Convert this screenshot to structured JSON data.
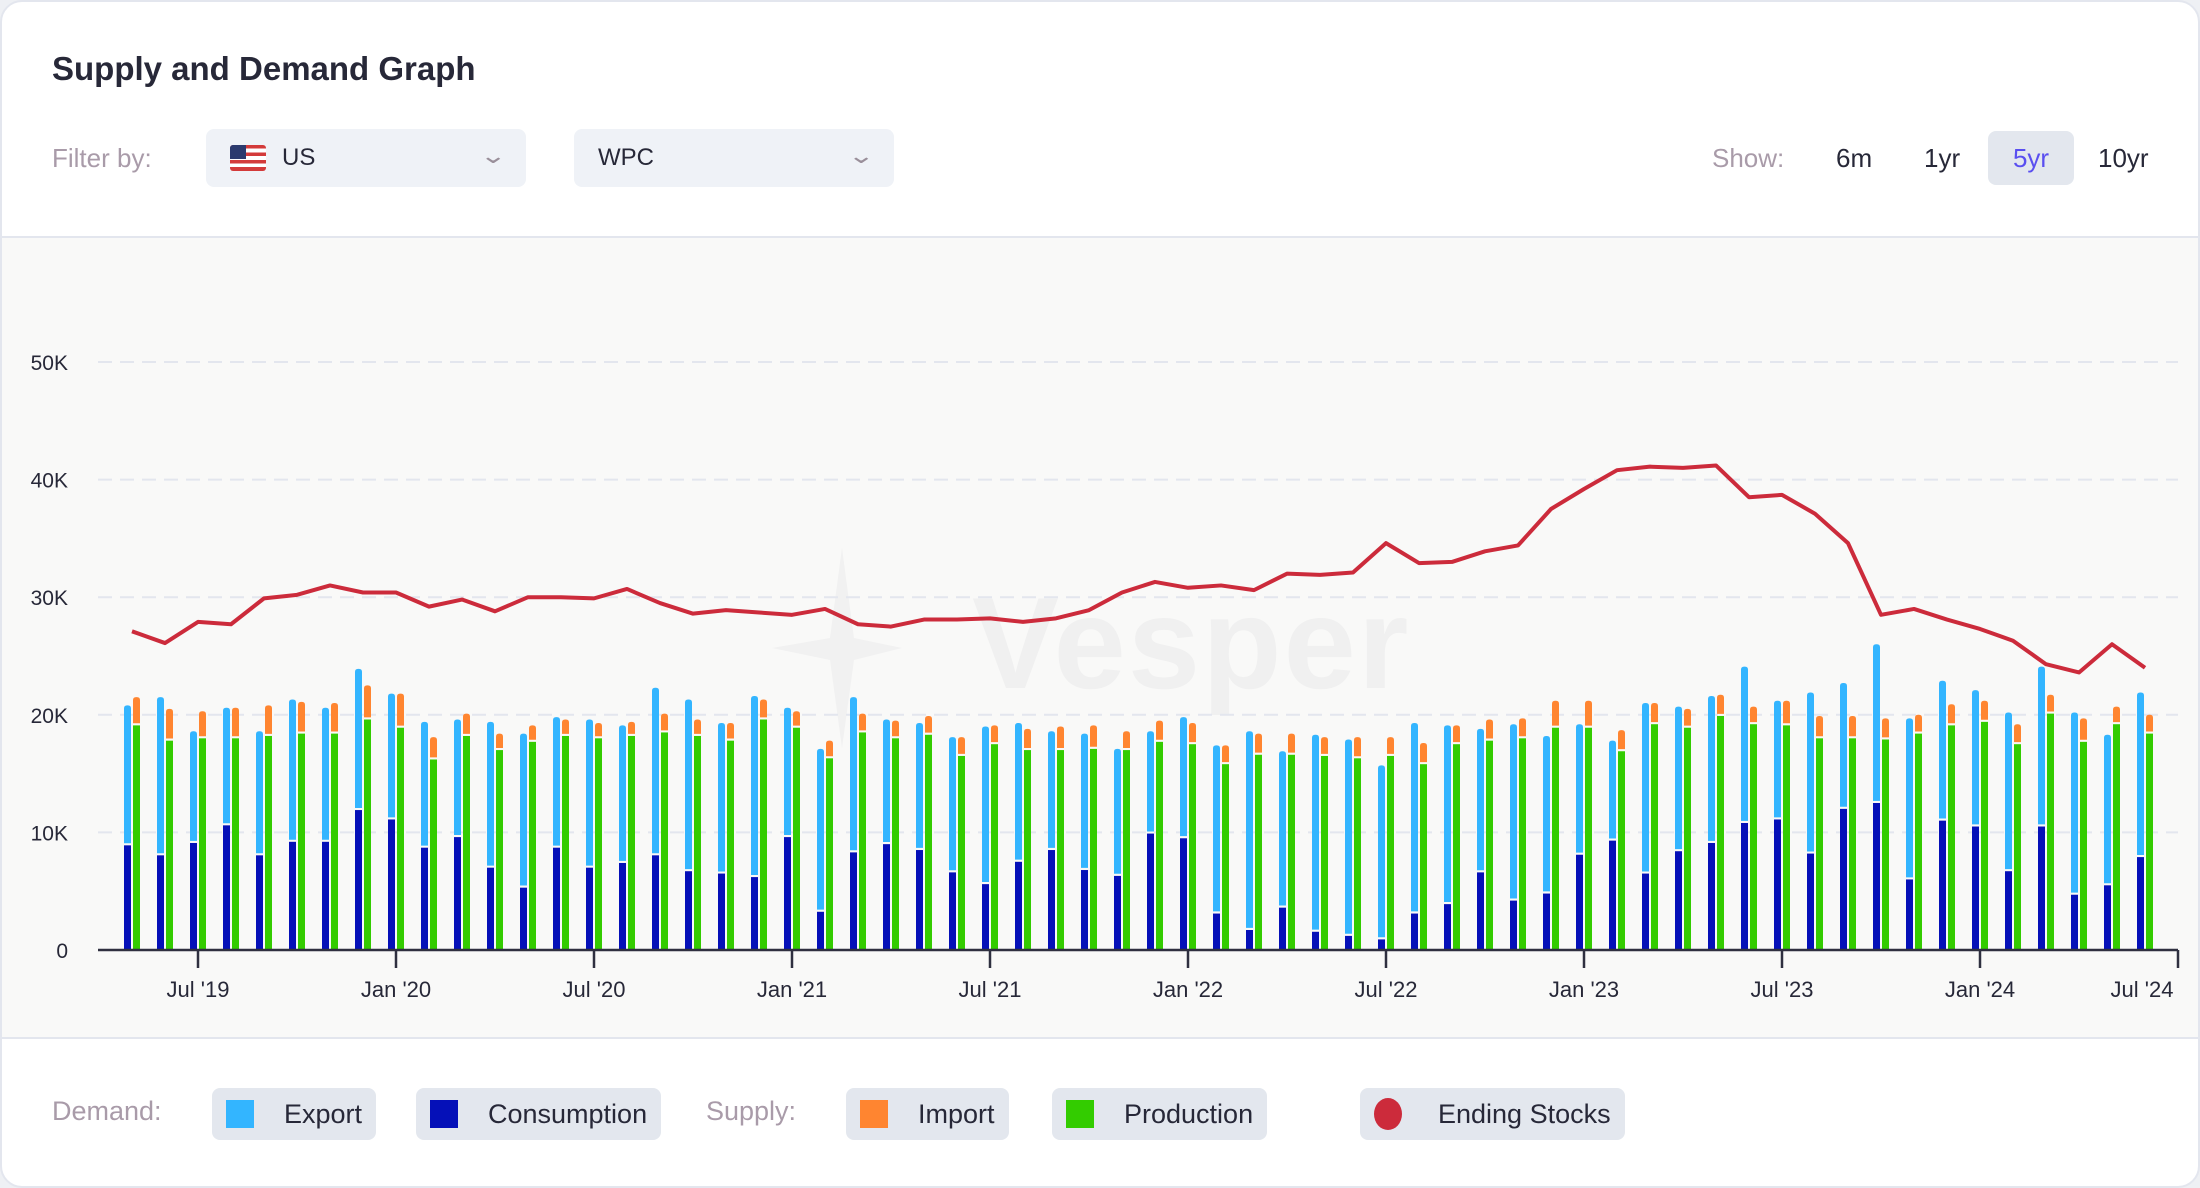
{
  "title": "Supply and Demand Graph",
  "filter": {
    "label": "Filter by:",
    "country": "US",
    "country_icon": "us-flag-icon",
    "product": "WPC"
  },
  "show": {
    "label": "Show:",
    "options": [
      "6m",
      "1yr",
      "5yr",
      "10yr"
    ],
    "selected": "5yr"
  },
  "watermark": "Vesper",
  "legend": {
    "demand_label": "Demand:",
    "supply_label": "Supply:",
    "items": [
      {
        "label": "Export",
        "color": "#33b5ff"
      },
      {
        "label": "Consumption",
        "color": "#0510b8"
      },
      {
        "label": "Import",
        "color": "#ff8530"
      },
      {
        "label": "Production",
        "color": "#33cc00"
      },
      {
        "label": "Ending Stocks",
        "color": "#cc2b3b"
      }
    ]
  },
  "chart_data": {
    "type": "bar",
    "stacked": true,
    "grid": true,
    "ylim": [
      0,
      50000
    ],
    "yticks": [
      "0",
      "10K",
      "20K",
      "30K",
      "40K",
      "50K"
    ],
    "xticks": [
      "Jul '19",
      "Jan '20",
      "Jul '20",
      "Jan '21",
      "Jul '21",
      "Jan '22",
      "Jul '22",
      "Jan '23",
      "Jul '23",
      "Jan '24",
      "Jul '24"
    ],
    "categories": [
      "2019-05",
      "2019-06",
      "2019-07",
      "2019-08",
      "2019-09",
      "2019-10",
      "2019-11",
      "2019-12",
      "2020-01",
      "2020-02",
      "2020-03",
      "2020-04",
      "2020-05",
      "2020-06",
      "2020-07",
      "2020-08",
      "2020-09",
      "2020-10",
      "2020-11",
      "2020-12",
      "2021-01",
      "2021-02",
      "2021-03",
      "2021-04",
      "2021-05",
      "2021-06",
      "2021-07",
      "2021-08",
      "2021-09",
      "2021-10",
      "2021-11",
      "2021-12",
      "2022-01",
      "2022-02",
      "2022-03",
      "2022-04",
      "2022-05",
      "2022-06",
      "2022-07",
      "2022-08",
      "2022-09",
      "2022-10",
      "2022-11",
      "2022-12",
      "2023-01",
      "2023-02",
      "2023-03",
      "2023-04",
      "2023-05",
      "2023-06",
      "2023-07",
      "2023-08",
      "2023-09",
      "2023-10",
      "2023-11",
      "2023-12",
      "2024-01",
      "2024-02",
      "2024-03",
      "2024-04",
      "2024-05",
      "2024-06"
    ],
    "series": [
      {
        "name": "Consumption",
        "stack": "Demand",
        "values": [
          8900,
          8050,
          9100,
          10600,
          8050,
          9200,
          9200,
          11900,
          11100,
          8700,
          9600,
          7000,
          5300,
          8700,
          7000,
          7400,
          8050,
          6700,
          6500,
          6200,
          9600,
          3250,
          8300,
          9000,
          8500,
          6600,
          5600,
          7500,
          8500,
          6800,
          6300,
          9900,
          9500,
          3100,
          1700,
          3600,
          1550,
          1200,
          900,
          3100,
          3900,
          6600,
          4200,
          4800,
          8100,
          9300,
          6500,
          8400,
          9100,
          10800,
          11100,
          8200,
          12000,
          12500,
          6000,
          11000,
          10500,
          6700,
          10500,
          4700,
          5500,
          7900
        ]
      },
      {
        "name": "Export",
        "stack": "Demand",
        "values": [
          11900,
          13450,
          9500,
          10000,
          10550,
          12100,
          11400,
          12000,
          10700,
          10700,
          10000,
          12400,
          13100,
          11100,
          12600,
          11700,
          14250,
          14600,
          12800,
          15400,
          11000,
          13850,
          13200,
          10600,
          10800,
          11500,
          13400,
          11800,
          10100,
          11600,
          10800,
          8700,
          10300,
          14300,
          16900,
          13300,
          16750,
          16700,
          14800,
          16200,
          15200,
          12200,
          15000,
          13400,
          11100,
          8500,
          14500,
          12300,
          12500,
          13300,
          10100,
          13700,
          10700,
          13500,
          13700,
          11900,
          11600,
          13500,
          13600,
          15500,
          12800,
          14000
        ]
      },
      {
        "name": "Production",
        "stack": "Supply",
        "values": [
          19100,
          17800,
          18000,
          18000,
          18200,
          18400,
          18400,
          19600,
          18900,
          16200,
          18200,
          17000,
          17700,
          18200,
          18000,
          18200,
          18500,
          18200,
          17800,
          19600,
          18900,
          16300,
          18500,
          18000,
          18300,
          16500,
          17500,
          17000,
          17000,
          17100,
          17000,
          17700,
          17500,
          15800,
          16600,
          16600,
          16500,
          16300,
          16500,
          15800,
          17500,
          17800,
          18000,
          18900,
          18900,
          16900,
          19200,
          18900,
          19900,
          19200,
          19100,
          18000,
          18000,
          17900,
          18400,
          19100,
          19400,
          17500,
          20100,
          17700,
          19200,
          18400
        ]
      },
      {
        "name": "Import",
        "stack": "Supply",
        "values": [
          2400,
          2700,
          2300,
          2600,
          2600,
          2700,
          2600,
          2900,
          2900,
          1900,
          1900,
          1400,
          1400,
          1400,
          1300,
          1200,
          1600,
          1400,
          1500,
          1700,
          1400,
          1500,
          1600,
          1500,
          1600,
          1600,
          1600,
          1800,
          2000,
          2000,
          1600,
          1800,
          1800,
          1600,
          1800,
          1800,
          1600,
          1800,
          1600,
          1800,
          1600,
          1800,
          1700,
          2300,
          2300,
          1800,
          1800,
          1600,
          1800,
          1500,
          2100,
          1900,
          1900,
          1800,
          1600,
          1800,
          1800,
          1700,
          1600,
          2000,
          1500,
          1600
        ]
      },
      {
        "name": "Ending Stocks",
        "type": "line",
        "values": [
          27100,
          26100,
          27900,
          27700,
          29900,
          30200,
          31000,
          30400,
          30400,
          29200,
          29800,
          28800,
          30000,
          30000,
          29900,
          30700,
          29500,
          28600,
          28900,
          28700,
          28500,
          29000,
          27700,
          27500,
          28100,
          28100,
          28200,
          27900,
          28200,
          28900,
          30400,
          31300,
          30800,
          31000,
          30600,
          32000,
          31900,
          32100,
          34600,
          32900,
          33000,
          33900,
          34400,
          37500,
          39200,
          40800,
          41100,
          41000,
          41200,
          38500,
          38700,
          37100,
          34600,
          28500,
          29000,
          28100,
          27300,
          26300,
          24300,
          23600,
          26000,
          24000
        ]
      }
    ]
  }
}
